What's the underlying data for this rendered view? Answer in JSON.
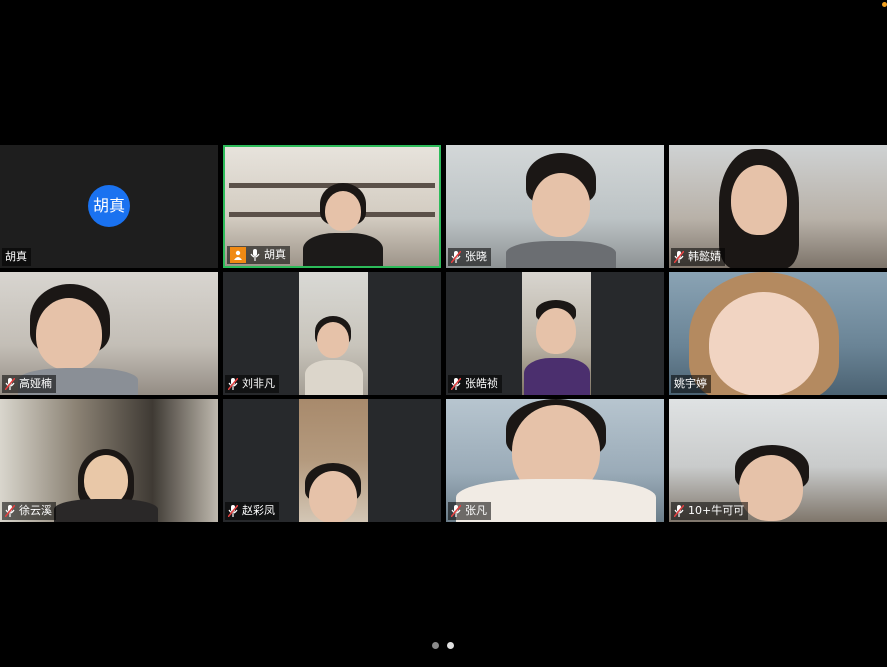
{
  "participants": [
    {
      "name": "胡真",
      "video": false,
      "mic": "none",
      "avatar_text": "胡真",
      "avatar_color": "#1a72f0"
    },
    {
      "name": "胡真",
      "video": true,
      "mic": "on",
      "host": true,
      "active_speaker": true
    },
    {
      "name": "张晓",
      "video": true,
      "mic": "muted"
    },
    {
      "name": "韩懿婧",
      "video": true,
      "mic": "muted"
    },
    {
      "name": "高娅楠",
      "video": true,
      "mic": "muted"
    },
    {
      "name": "刘非凡",
      "video": true,
      "mic": "muted",
      "portrait": true
    },
    {
      "name": "张皓祯",
      "video": true,
      "mic": "muted",
      "portrait": true
    },
    {
      "name": "姚宇婷",
      "video": true,
      "mic": "none"
    },
    {
      "name": "徐云溪",
      "video": true,
      "mic": "muted"
    },
    {
      "name": "赵彩凤",
      "video": true,
      "mic": "muted",
      "portrait": true
    },
    {
      "name": "张凡",
      "video": true,
      "mic": "muted"
    },
    {
      "name": "10+牛可可",
      "video": true,
      "mic": "muted"
    }
  ],
  "colors": {
    "background": "#000000",
    "tile_background": "#1e1e1e",
    "active_border": "#2dbb5a",
    "host_badge": "#f08a14",
    "avatar_blue": "#1a72f0",
    "muted_slash": "#e04040"
  },
  "pagination": {
    "total_pages": 2,
    "current_page": 2
  },
  "icons": {
    "muted": "mic-muted-icon",
    "mic": "mic-icon",
    "host": "host-person-icon"
  }
}
